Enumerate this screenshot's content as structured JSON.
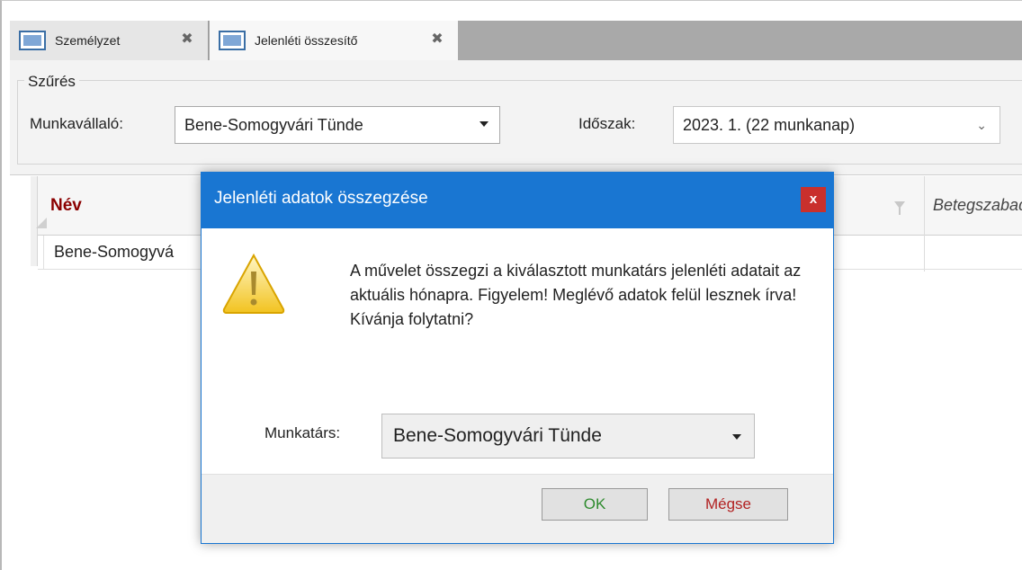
{
  "tabs": [
    {
      "label": "Személyzet",
      "close_icon": "close-icon"
    },
    {
      "label": "Jelenléti összesítő",
      "close_icon": "close-icon"
    }
  ],
  "filter": {
    "group_title": "Szűrés",
    "employee_label": "Munkavállaló:",
    "employee_value": "Bene-Somogyvári Tünde",
    "period_label": "Időszak:",
    "period_value": "2023. 1. (22 munkanap)"
  },
  "grid": {
    "columns": [
      "Név",
      "Betegszabad"
    ],
    "rows": [
      {
        "name": "Bene-Somogyvá"
      }
    ]
  },
  "dialog": {
    "title": "Jelenléti adatok összegzése",
    "close_label": "x",
    "message": "A művelet összegzi a kiválasztott munkatárs jelenléti adatait az aktuális hónapra. Figyelem! Meglévő adatok felül lesznek írva! Kívánja folytatni?",
    "employee_label": "Munkatárs:",
    "employee_value": "Bene-Somogyvári Tünde",
    "ok_label": "OK",
    "cancel_label": "Mégse",
    "icon": "warning-icon"
  },
  "colors": {
    "title_bar": "#1976d2",
    "close_button": "#c9302c",
    "header_name": "#8b0000",
    "ok_text": "#2e8b2e",
    "cancel_text": "#b22222"
  }
}
